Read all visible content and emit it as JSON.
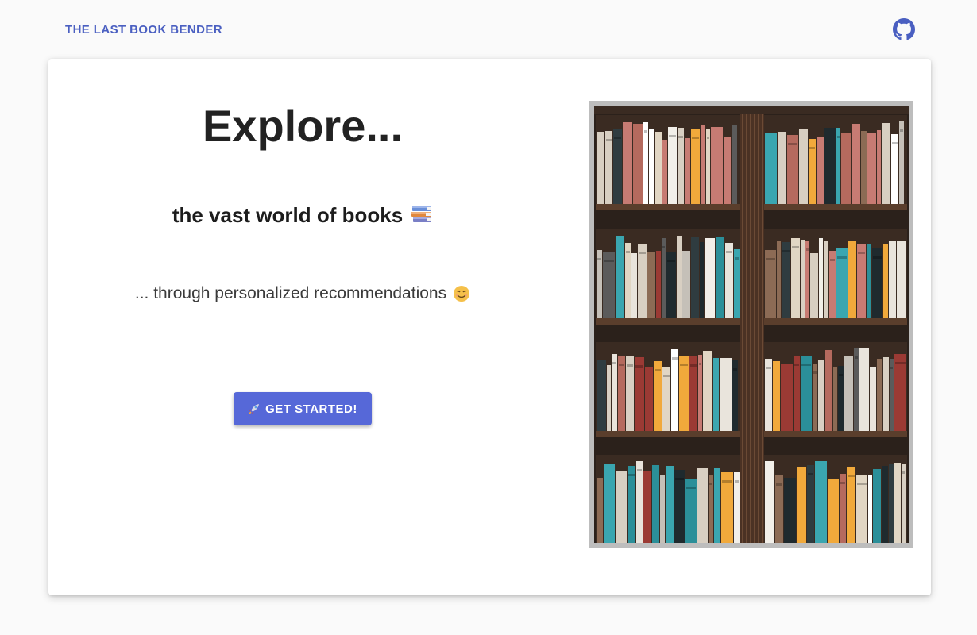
{
  "header": {
    "brand": "THE LAST BOOK BENDER",
    "github_icon": "github-icon"
  },
  "hero": {
    "title": "Explore...",
    "subtitle": "the vast world of books",
    "subtitle_icon": "books-icon",
    "tagline": "... through personalized recommendations",
    "tagline_icon": "smiley-icon",
    "cta_label": "GET STARTED!",
    "cta_icon": "rocket-icon"
  },
  "image": {
    "subject": "bookshelf-photo"
  },
  "colors": {
    "brand": "#4a5fc1",
    "button": "#5668d8",
    "background": "#fafafa"
  }
}
